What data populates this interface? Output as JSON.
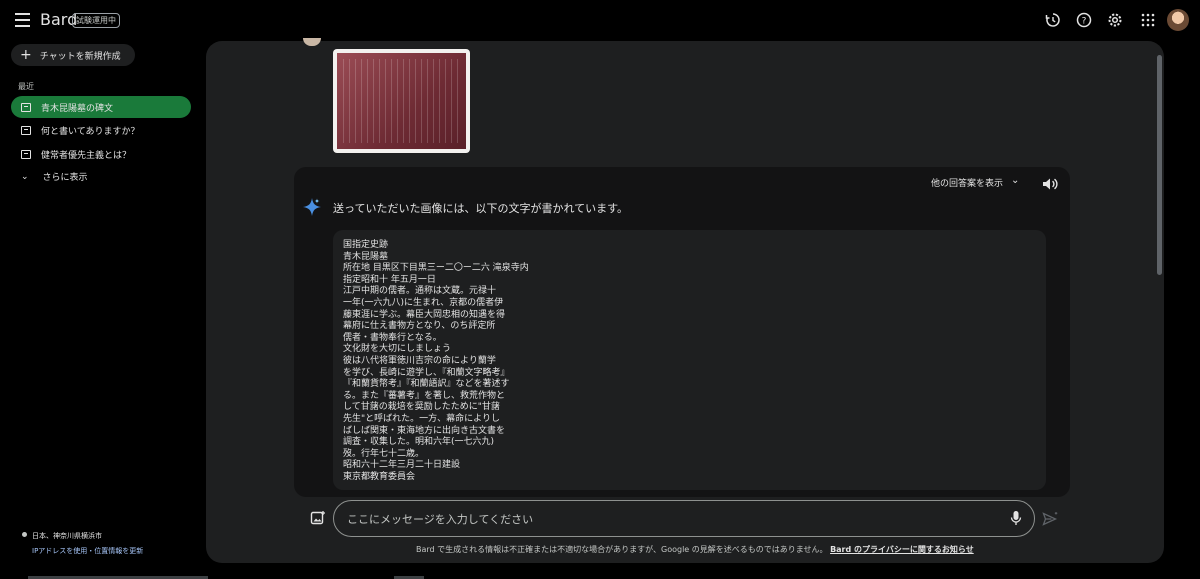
{
  "app": {
    "brand": "Bard",
    "badge": "試験運用中"
  },
  "sidebar": {
    "new_chat_label": "チャットを新規作成",
    "recent_label": "最近",
    "items": [
      {
        "label": "青木昆陽墓の碑文",
        "active": true
      },
      {
        "label": "何と書いてありますか？",
        "active": false
      },
      {
        "label": "健常者優先主義とは？",
        "active": false
      }
    ],
    "more_label": "さらに表示",
    "location": "日本、神奈川県横浜市",
    "location_link": "IPアドレスを使用・位置情報を更新"
  },
  "header_icons": [
    "history-icon",
    "help-icon",
    "settings-icon",
    "apps-icon",
    "avatar"
  ],
  "response": {
    "drafts_label": "他の回答案を表示",
    "title": "送っていただいた画像には、以下の文字が書かれています。",
    "lines": [
      "国指定史跡",
      "青木昆陽墓",
      "所在地  目黒区下目黒三ー二〇ー二六  滝泉寺内",
      "指定昭和十  年五月一日",
      "江戸中期の儒者。通称は文蔵。元禄十",
      "一年(一六九八)に生まれ、京都の儒者伊",
      "藤東涯に学ぶ。幕臣大岡忠相の知遇を得",
      "幕府に仕え書物方となり、のち評定所",
      "儒者・書物奉行となる。",
      "文化財を大切にしましょう",
      "彼は八代将軍徳川吉宗の命により蘭学",
      "を学び、長崎に遊学し、『和蘭文字略考』",
      "『和蘭貨幣考』『和蘭語訳』などを著述す",
      "る。また『蕃薯考』を著し、救荒作物と",
      "して甘藷の栽培を奨励したために\"甘藷",
      "先生\"と呼ばれた。一方、幕命によりし",
      "ばしば関東・東海地方に出向き古文書を",
      "調査・収集した。明和六年(一七六九)",
      "歿。行年七十二歳。",
      "昭和六十二年三月二十日建設",
      "東京都教育委員会"
    ]
  },
  "input": {
    "placeholder": "ここにメッセージを入力してください"
  },
  "footer": {
    "disclaimer": "Bard で生成される情報は不正確または不適切な場合がありますが、Google の見解を述べるものではありません。",
    "privacy_link": "Bard のプライバシーに関するお知らせ"
  },
  "colors": {
    "accent_active": "#1a7a3a",
    "panel": "#1e1f20",
    "background": "#000000"
  }
}
